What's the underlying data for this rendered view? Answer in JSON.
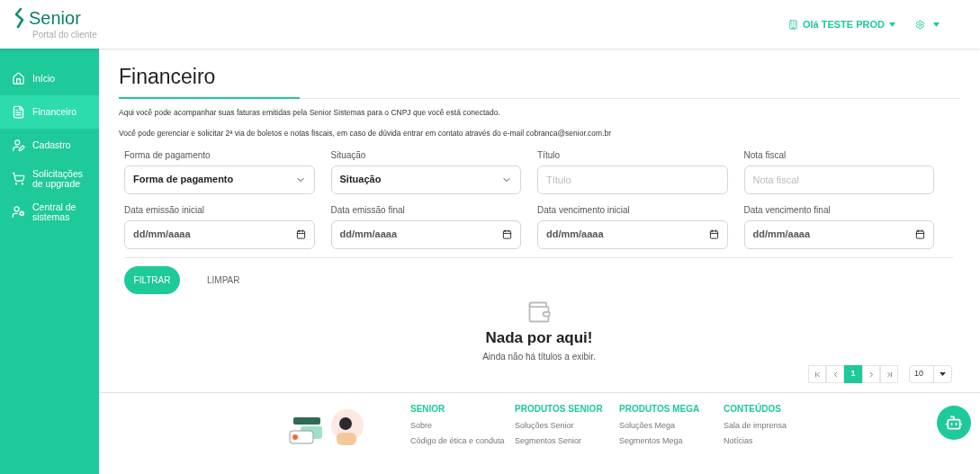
{
  "header": {
    "logo": "Senior",
    "subtitle": "Portal do cliente",
    "user": "Olá TESTE PROD"
  },
  "sidebar": {
    "items": [
      {
        "label": "Início",
        "kind": "home",
        "selected": false
      },
      {
        "label": "Financeiro",
        "kind": "invoice",
        "selected": true
      },
      {
        "label": "Cadastro",
        "kind": "user-edit",
        "selected": false
      },
      {
        "label": "Solicitações de upgrade",
        "kind": "cart",
        "selected": false
      },
      {
        "label": "Central de sistemas",
        "kind": "user-settings",
        "selected": false
      }
    ]
  },
  "page": {
    "title": "Financeiro",
    "paragraphs": [
      "Aqui você pode acompanhar suas faturas emitidas pela Senior Sistemas para o CNPJ que você está conectado.",
      "Você pode gerenciar e solicitar 2ª via de boletos e notas fiscais, em caso de dúvida entrar em contato através do e-mail cobranca@senior.com.br"
    ]
  },
  "filters": [
    {
      "label": "Forma de pagamento",
      "kind": "select",
      "value": "Forma de pagamento"
    },
    {
      "label": "Situação",
      "kind": "select",
      "value": "Situação"
    },
    {
      "label": "Título",
      "kind": "text",
      "placeholder": "Título"
    },
    {
      "label": "Nota fiscal",
      "kind": "text",
      "placeholder": "Nota fiscal"
    },
    {
      "label": "Data emissão inicial",
      "kind": "date",
      "value": "dd/mm/aaaa"
    },
    {
      "label": "Data emissão final",
      "kind": "date",
      "value": "dd/mm/aaaa"
    },
    {
      "label": "Data vencimento inicial",
      "kind": "date",
      "value": "dd/mm/aaaa"
    },
    {
      "label": "Data vencimento final",
      "kind": "date",
      "value": "dd/mm/aaaa"
    }
  ],
  "actions": {
    "filter": "FILTRAR",
    "clear": "LIMPAR"
  },
  "empty_state": {
    "title": "Nada por aqui!",
    "message": "Ainda não há títulos a exibir."
  },
  "pagination": {
    "pages": [
      {
        "label": "1",
        "selected": true
      }
    ],
    "page_size": "10"
  },
  "footer": {
    "columns": [
      {
        "heading": "SENIOR",
        "links": [
          "Sobre",
          "Código de ética e conduta"
        ]
      },
      {
        "heading": "PRODUTOS SENIOR",
        "links": [
          "Soluções Senior",
          "Segmentos Senior"
        ]
      },
      {
        "heading": "PRODUTOS MEGA",
        "links": [
          "Soluções Mega",
          "Segmentos Mega"
        ]
      },
      {
        "heading": "CONTEÚDOS",
        "links": [
          "Sala de imprensa",
          "Notícias"
        ]
      }
    ]
  }
}
